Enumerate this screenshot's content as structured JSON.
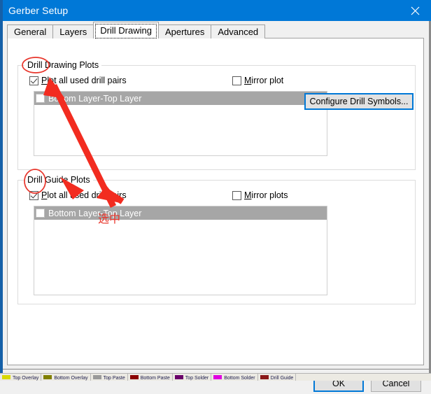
{
  "window": {
    "title": "Gerber Setup",
    "close_icon": "close-icon",
    "title_bar_color": "#0078d7"
  },
  "tabs": [
    {
      "label": "General",
      "selected": false
    },
    {
      "label": "Layers",
      "selected": false
    },
    {
      "label": "Drill Drawing",
      "selected": true
    },
    {
      "label": "Apertures",
      "selected": false
    },
    {
      "label": "Advanced",
      "selected": false
    }
  ],
  "groups": {
    "drill_drawing": {
      "title": "Drill Drawing Plots",
      "plot_all_checkbox": {
        "label_prefix": "",
        "label_accel": "P",
        "label_rest": "lot all used drill pairs",
        "checked": true
      },
      "mirror_checkbox": {
        "label_accel": "M",
        "label_rest": "irror plot",
        "checked": false
      },
      "configure_button": "Configure Drill Symbols...",
      "list_items": [
        {
          "label": "Bottom Layer-Top Layer",
          "checked": false,
          "selected": true
        }
      ]
    },
    "drill_guide": {
      "title": "Drill Guide Plots",
      "plot_all_checkbox": {
        "label_accel": "P",
        "label_rest": "lot all used drill pairs",
        "checked": true
      },
      "mirror_checkbox": {
        "label_accel": "M",
        "label_rest": "irror plots",
        "checked": false
      },
      "list_items": [
        {
          "label": "Bottom Layer-Top Layer",
          "checked": false,
          "selected": true
        }
      ]
    }
  },
  "footer": {
    "ok_label": "OK",
    "cancel_label": "Cancel"
  },
  "annotations": {
    "note_text": "选中",
    "color": "#e8352b"
  },
  "layer_tabs": [
    {
      "label": "Top Overlay",
      "color": "#d8d800"
    },
    {
      "label": "Bottom Overlay",
      "color": "#808000"
    },
    {
      "label": "Top Paste",
      "color": "#9a9a9a"
    },
    {
      "label": "Bottom Paste",
      "color": "#8b0000"
    },
    {
      "label": "Top Solder",
      "color": "#6a006a"
    },
    {
      "label": "Bottom Solder",
      "color": "#e000e0"
    },
    {
      "label": "Drill Guide",
      "color": "#8b1a1a"
    }
  ]
}
